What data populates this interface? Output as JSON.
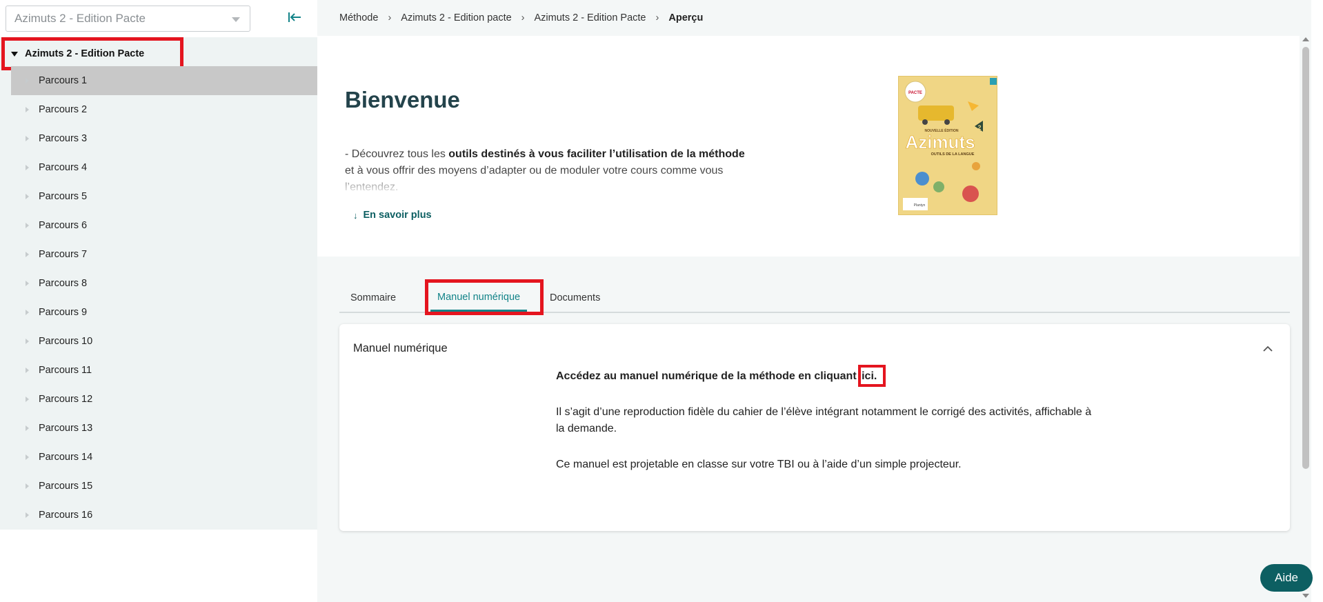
{
  "sidebar": {
    "method_select": {
      "value": "Azimuts 2 - Edition Pacte"
    },
    "tree": {
      "root_label": "Azimuts 2 - Edition Pacte",
      "items": [
        "Parcours 1",
        "Parcours 2",
        "Parcours 3",
        "Parcours 4",
        "Parcours 5",
        "Parcours 6",
        "Parcours 7",
        "Parcours 8",
        "Parcours 9",
        "Parcours 10",
        "Parcours 11",
        "Parcours 12",
        "Parcours 13",
        "Parcours 14",
        "Parcours 15",
        "Parcours 16"
      ]
    }
  },
  "breadcrumb": {
    "items": [
      "Méthode",
      "Azimuts 2 - Edition pacte",
      "Azimuts 2 - Edition Pacte"
    ],
    "current": "Aperçu"
  },
  "hero": {
    "title": "Bienvenue",
    "text_prefix": "- Découvrez tous les ",
    "text_bold1": "outils destinés à vous faciliter l’utilisation de la méthode",
    "text_rest": " et à vous offrir des moyens d’adapter ou de moduler votre cours comme vous l’entendez.",
    "more_link": "En savoir plus",
    "book": {
      "badge_top": "PACTE",
      "edition": "NOUVELLE ÉDITION",
      "title": "Azimuts",
      "level": "2",
      "subtitle": "OUTILS DE LA LANGUE",
      "publisher": "Plantyn"
    }
  },
  "tabs": [
    "Sommaire",
    "Manuel numérique",
    "Documents"
  ],
  "active_tab": "Manuel numérique",
  "card": {
    "title": "Manuel numérique",
    "line1_text": "Accédez au manuel numérique de la méthode en cliquant ",
    "line1_link": "ici.",
    "para2": "Il s’agit d’une reproduction fidèle du cahier de l’élève intégrant notamment le corrigé des activités, affichable à la demande.",
    "para3": "Ce manuel est projetable en classe sur votre TBI ou à l’aide d’un simple projecteur."
  },
  "help_button": "Aide",
  "colors": {
    "accent": "#128388",
    "dark_teal": "#0d5f62",
    "highlight": "#e4151f",
    "sidebar_bg": "#eef3f3"
  }
}
